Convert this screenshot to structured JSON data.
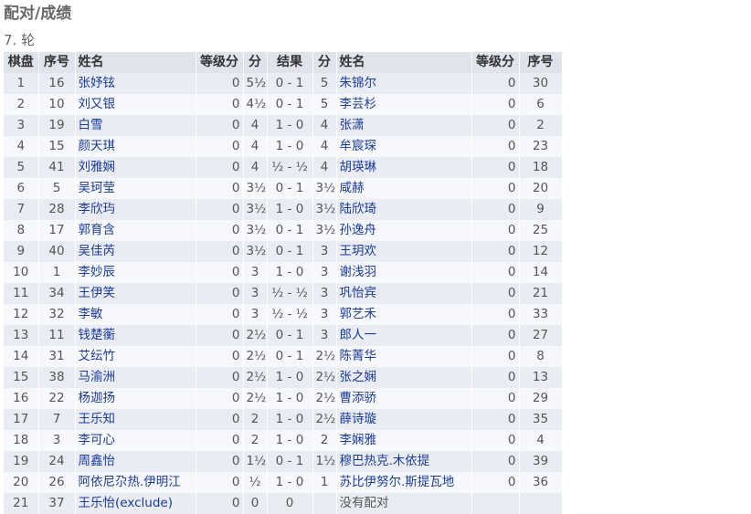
{
  "page": {
    "title": "配对/成绩",
    "round": "7. 轮"
  },
  "table": {
    "headers": {
      "board": "棋盘",
      "no_white": "序号",
      "name_white": "姓名",
      "rating_white": "等级分",
      "points_white": "分",
      "result": "结果",
      "points_black": "分",
      "name_black": "姓名",
      "rating_black": "等级分",
      "no_black": "序号"
    },
    "rows": [
      {
        "board": "1",
        "no_w": "16",
        "name_w": "张妤铉",
        "rtg_w": "0",
        "pts_w": "5½",
        "result": "0 - 1",
        "pts_b": "5",
        "name_b": "朱锦尔",
        "rtg_b": "0",
        "no_b": "30"
      },
      {
        "board": "2",
        "no_w": "10",
        "name_w": "刘又银",
        "rtg_w": "0",
        "pts_w": "4½",
        "result": "0 - 1",
        "pts_b": "5",
        "name_b": "李芸杉",
        "rtg_b": "0",
        "no_b": "6"
      },
      {
        "board": "3",
        "no_w": "19",
        "name_w": "白雪",
        "rtg_w": "0",
        "pts_w": "4",
        "result": "1 - 0",
        "pts_b": "4",
        "name_b": "张潇",
        "rtg_b": "0",
        "no_b": "2"
      },
      {
        "board": "4",
        "no_w": "15",
        "name_w": "颜天琪",
        "rtg_w": "0",
        "pts_w": "4",
        "result": "1 - 0",
        "pts_b": "4",
        "name_b": "牟宸琛",
        "rtg_b": "0",
        "no_b": "23"
      },
      {
        "board": "5",
        "no_w": "41",
        "name_w": "刘雅娴",
        "rtg_w": "0",
        "pts_w": "4",
        "result": "½ - ½",
        "pts_b": "4",
        "name_b": "胡瑛琳",
        "rtg_b": "0",
        "no_b": "18"
      },
      {
        "board": "6",
        "no_w": "5",
        "name_w": "吴珂莹",
        "rtg_w": "0",
        "pts_w": "3½",
        "result": "0 - 1",
        "pts_b": "3½",
        "name_b": "咸赫",
        "rtg_b": "0",
        "no_b": "20"
      },
      {
        "board": "7",
        "no_w": "28",
        "name_w": "李欣玙",
        "rtg_w": "0",
        "pts_w": "3½",
        "result": "1 - 0",
        "pts_b": "3½",
        "name_b": "陆欣琦",
        "rtg_b": "0",
        "no_b": "9"
      },
      {
        "board": "8",
        "no_w": "17",
        "name_w": "郭育含",
        "rtg_w": "0",
        "pts_w": "3½",
        "result": "0 - 1",
        "pts_b": "3½",
        "name_b": "孙逸舟",
        "rtg_b": "0",
        "no_b": "25"
      },
      {
        "board": "9",
        "no_w": "40",
        "name_w": "吴佳芮",
        "rtg_w": "0",
        "pts_w": "3½",
        "result": "0 - 1",
        "pts_b": "3",
        "name_b": "王玥欢",
        "rtg_b": "0",
        "no_b": "12"
      },
      {
        "board": "10",
        "no_w": "1",
        "name_w": "李妙辰",
        "rtg_w": "0",
        "pts_w": "3",
        "result": "1 - 0",
        "pts_b": "3",
        "name_b": "谢浅羽",
        "rtg_b": "0",
        "no_b": "14"
      },
      {
        "board": "11",
        "no_w": "34",
        "name_w": "王伊笑",
        "rtg_w": "0",
        "pts_w": "3",
        "result": "½ - ½",
        "pts_b": "3",
        "name_b": "巩怡宾",
        "rtg_b": "0",
        "no_b": "21"
      },
      {
        "board": "12",
        "no_w": "32",
        "name_w": "李敏",
        "rtg_w": "0",
        "pts_w": "3",
        "result": "½ - ½",
        "pts_b": "3",
        "name_b": "郭艺禾",
        "rtg_b": "0",
        "no_b": "33"
      },
      {
        "board": "13",
        "no_w": "11",
        "name_w": "钱楚蘅",
        "rtg_w": "0",
        "pts_w": "2½",
        "result": "0 - 1",
        "pts_b": "3",
        "name_b": "郎人一",
        "rtg_b": "0",
        "no_b": "27"
      },
      {
        "board": "14",
        "no_w": "31",
        "name_w": "艾纭竹",
        "rtg_w": "0",
        "pts_w": "2½",
        "result": "0 - 1",
        "pts_b": "2½",
        "name_b": "陈菁华",
        "rtg_b": "0",
        "no_b": "8"
      },
      {
        "board": "15",
        "no_w": "38",
        "name_w": "马渝洲",
        "rtg_w": "0",
        "pts_w": "2½",
        "result": "1 - 0",
        "pts_b": "2½",
        "name_b": "张之娴",
        "rtg_b": "0",
        "no_b": "13"
      },
      {
        "board": "16",
        "no_w": "22",
        "name_w": "杨迦扬",
        "rtg_w": "0",
        "pts_w": "2½",
        "result": "1 - 0",
        "pts_b": "2½",
        "name_b": "曹添骄",
        "rtg_b": "0",
        "no_b": "29"
      },
      {
        "board": "17",
        "no_w": "7",
        "name_w": "王乐知",
        "rtg_w": "0",
        "pts_w": "2",
        "result": "1 - 0",
        "pts_b": "2½",
        "name_b": "薛诗璇",
        "rtg_b": "0",
        "no_b": "35"
      },
      {
        "board": "18",
        "no_w": "3",
        "name_w": "李可心",
        "rtg_w": "0",
        "pts_w": "2",
        "result": "1 - 0",
        "pts_b": "2",
        "name_b": "李娴雅",
        "rtg_b": "0",
        "no_b": "4"
      },
      {
        "board": "19",
        "no_w": "24",
        "name_w": "周鑫怡",
        "rtg_w": "0",
        "pts_w": "1½",
        "result": "0 - 1",
        "pts_b": "1½",
        "name_b": "穆巴热克.木依提",
        "rtg_b": "0",
        "no_b": "39"
      },
      {
        "board": "20",
        "no_w": "26",
        "name_w": "阿依尼尕热.伊明江",
        "rtg_w": "0",
        "pts_w": "½",
        "result": "1 - 0",
        "pts_b": "1",
        "name_b": "苏比伊努尔.斯提瓦地",
        "rtg_b": "0",
        "no_b": "36"
      },
      {
        "board": "21",
        "no_w": "37",
        "name_w": "王乐怡(exclude)",
        "rtg_w": "0",
        "pts_w": "0",
        "result": "0",
        "pts_b": "",
        "name_b": "没有配对",
        "rtg_b": "",
        "no_b": ""
      }
    ]
  },
  "colors": {
    "header_bg": "#dfe3ec",
    "row_odd": "#e9ecf3",
    "row_even": "#f7f8fb",
    "link": "#1b3a9a"
  }
}
